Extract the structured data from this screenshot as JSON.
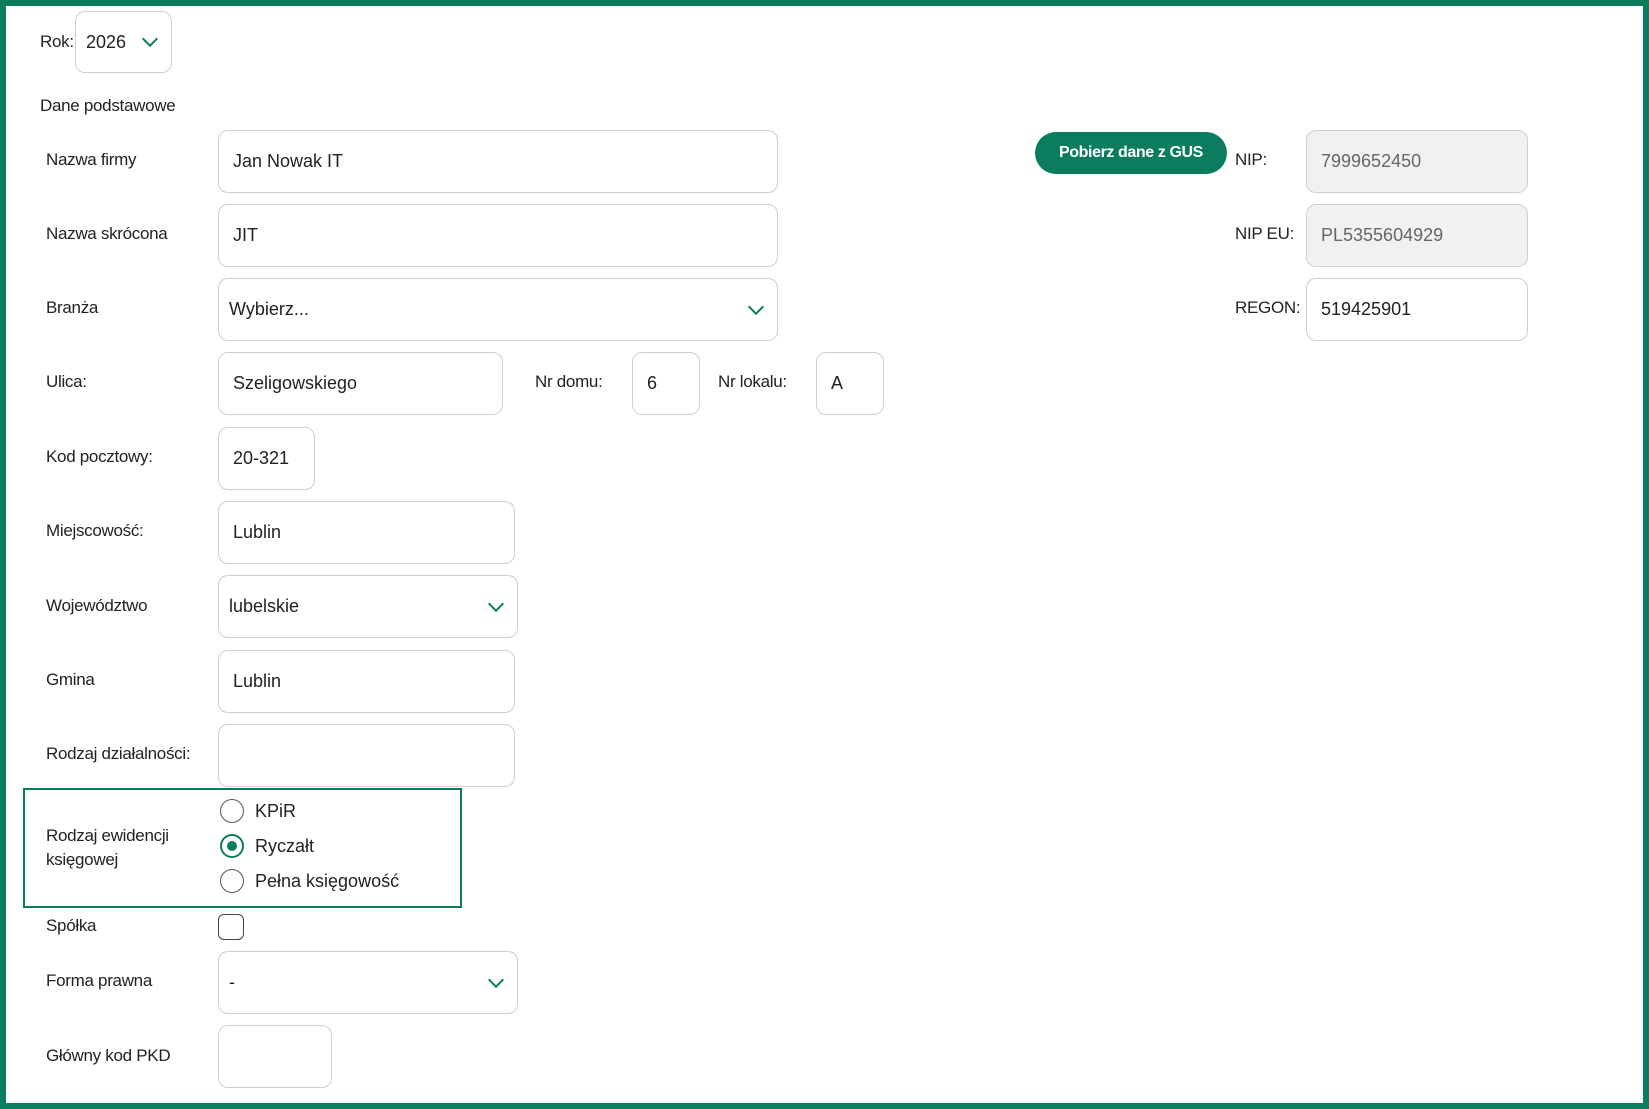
{
  "year": {
    "label": "Rok:",
    "value": "2026"
  },
  "section_title": "Dane podstawowe",
  "gus_button": "Pobierz dane z GUS",
  "fields": {
    "company_name": {
      "label": "Nazwa firmy",
      "value": "Jan Nowak IT"
    },
    "short_name": {
      "label": "Nazwa skrócona",
      "value": "JIT"
    },
    "industry": {
      "label": "Branża",
      "value": "Wybierz..."
    },
    "street": {
      "label": "Ulica:",
      "value": "Szeligowskiego"
    },
    "house_no": {
      "label": "Nr domu:",
      "value": "6"
    },
    "apartment_no": {
      "label": "Nr lokalu:",
      "value": "A"
    },
    "postal_code": {
      "label": "Kod pocztowy:",
      "value": "20-321"
    },
    "city": {
      "label": "Miejscowość:",
      "value": "Lublin"
    },
    "voivodeship": {
      "label": "Województwo",
      "value": "lubelskie"
    },
    "commune": {
      "label": "Gmina",
      "value": "Lublin"
    },
    "activity_type": {
      "label": "Rodzaj działalności:",
      "value": ""
    },
    "nip": {
      "label": "NIP:",
      "value": "7999652450"
    },
    "nip_eu": {
      "label": "NIP EU:",
      "value": "PL5355604929"
    },
    "regon": {
      "label": "REGON:",
      "value": "519425901"
    },
    "company_flag": {
      "label": "Spółka",
      "checked": false
    },
    "legal_form": {
      "label": "Forma prawna",
      "value": "-"
    },
    "pkd": {
      "label": "Główny kod PKD",
      "value": ""
    }
  },
  "accounting": {
    "label_line1": "Rodzaj ewidencji",
    "label_line2": "księgowej",
    "options": [
      "KPiR",
      "Ryczałt",
      "Pełna księgowość"
    ],
    "selected": "Ryczałt"
  },
  "colors": {
    "accent": "#0b7d5e",
    "border": "#cfcfcf",
    "disabled_bg": "#f1f1f1"
  },
  "icons": {
    "dropdown": "chevron-down-icon"
  }
}
